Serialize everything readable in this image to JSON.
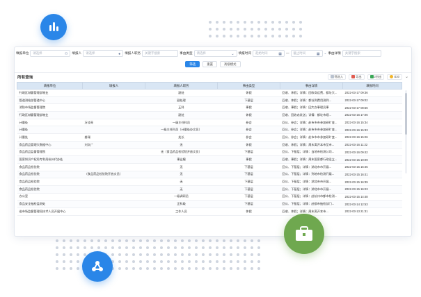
{
  "filters": [
    {
      "label": "填报单位",
      "placeholder": "请选择",
      "icon": "network-icon"
    },
    {
      "label": "填报人",
      "placeholder": "请选择",
      "icon": "person-icon"
    },
    {
      "label": "填报人职务",
      "placeholder": "关键字搜索"
    },
    {
      "label": "事由类型",
      "placeholder": "请选择",
      "icon": "chevron-down-icon"
    },
    {
      "label": "填报时间",
      "from_placeholder": "起始时间",
      "to_placeholder": "截止时间"
    },
    {
      "label": "事由详情",
      "placeholder": "关键字搜索"
    }
  ],
  "buttons": {
    "search": "筛选",
    "reset": "重置",
    "advanced": "高级模式"
  },
  "result_title": "所有查询",
  "tools": {
    "export": "筛选入",
    "favorite": "导出",
    "excel": "2份出",
    "more": "Ɑ30"
  },
  "colors": {
    "primary": "#2a86e8",
    "header_bg": "#d9e6f4",
    "green_circle": "#6fa84f",
    "blue_circle": "#2a86e8"
  },
  "table": {
    "headers": [
      "填报单位",
      "填报人",
      "填报人职务",
      "事由类型",
      "事由详情",
      "填报时间"
    ],
    "rows": [
      [
        "行政区城督管理部物业",
        "",
        "副处",
        "休假",
        "回收、休假；详情：回收商运费，都址大...",
        "2022-03-17 09:36"
      ],
      [
        "管道测绘部管道中心",
        "",
        "副处理",
        "下基层",
        "回收、休假；详情：都址到费用测到...",
        "2022-03-17 09:02"
      ],
      [
        "消防市场监督管理院",
        "",
        "正科",
        "事假",
        "回收、事假；详情：回大办事理员事",
        "2022-03-17 08:56"
      ],
      [
        "行政区城督管理部物业",
        "",
        "副处",
        "休假",
        "回收、回收态发送；详情：都址市规...",
        "2022-03-16 17:06"
      ],
      [
        "计量处",
        "万佳亮",
        "一级主任科员",
        "参会",
        "回公、参会；详情：赴市市市参加研旷变...",
        "2022-03-16 15:34"
      ],
      [
        "计量处",
        "",
        "一级主任科员（计量处办文员）",
        "参会",
        "回公、参会；详情：赴市市市参加研旷变...",
        "2022-03-16 15:33"
      ],
      [
        "计量处",
        "姜瑞",
        "处长",
        "参会",
        "回公、参会；详情：赴市市市参加研旷变...",
        "2022-03-16 15:26"
      ],
      [
        "食品药品管理大数据中心",
        "刘文广",
        "无",
        "休假",
        "回收、休假；详情：周末离开本市至市...",
        "2022-03-16 11:22"
      ],
      [
        "食品药品监督管理院",
        "",
        "无（食品药品检验院开放文员）",
        "下基层",
        "回公、下基层；详情：当地市检测公司...",
        "2022-03-16 09:42"
      ],
      [
        "国家知识产权局专利局杭州代办处",
        "",
        "事业编",
        "事假",
        "回收、事假；详情：周末国家都行政设立...",
        "2022-03-15 19:09"
      ],
      [
        "食品药品检验院",
        "",
        "无",
        "下基层",
        "回公、下基层；详情：湖北市市开展...",
        "2022-03-15 16:45"
      ],
      [
        "食品药品检验院",
        "（食品药品检验院开放文员）",
        "无",
        "下基层",
        "回公、下基层；详情：到地市检测开展...",
        "2022-03-15 16:41"
      ],
      [
        "食品药品检验院",
        "",
        "无",
        "下基层",
        "回公、下基层；详情：湖北市市开展...",
        "2022-03-15 16:39"
      ],
      [
        "食品药品检验院",
        "",
        "无",
        "下基层",
        "回公、下基层；详情：湖北市市开展...",
        "2022-03-15 16:23"
      ],
      [
        "办公室",
        "",
        "一级调研员",
        "下基层",
        "回公、下基层；详情：赴杭州市都市检测...",
        "2022-03-15 14:48"
      ],
      [
        "食品安全抽检监测处",
        "",
        "正科级",
        "下基层",
        "回公、下基层；详情：赴都市抽检部门...",
        "2022-03-14 12:53"
      ],
      [
        "省市场监督管理局技术人员开展中心",
        "",
        "工作人员",
        "休假",
        "回收、休假；详情：周末离开本市...",
        "2022-03-13 21:31"
      ]
    ]
  }
}
